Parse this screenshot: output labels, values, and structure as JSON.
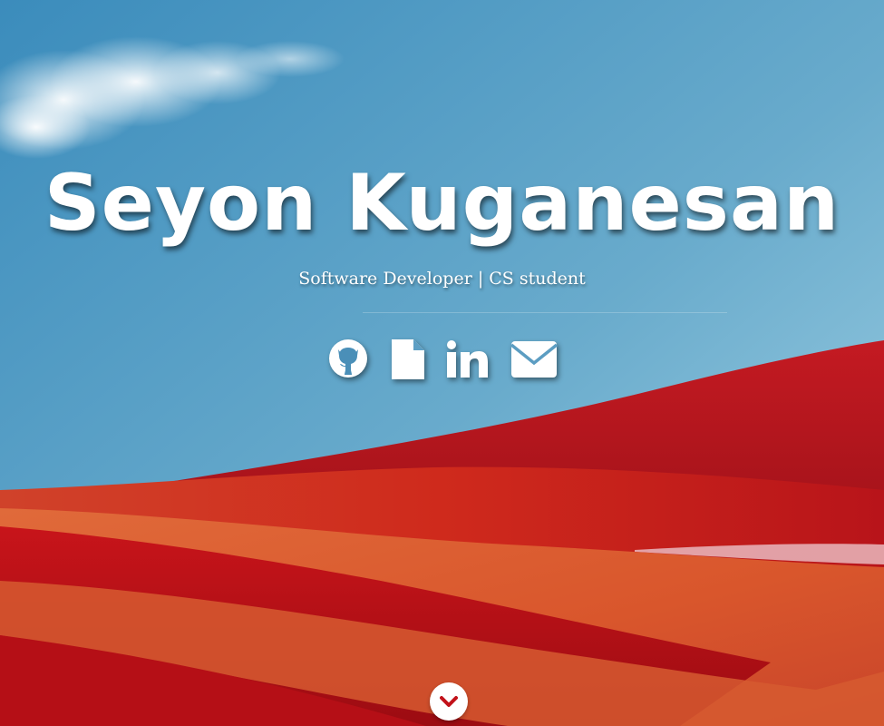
{
  "hero": {
    "name": "Seyon Kuganesan",
    "tagline": "Software Developer | CS student"
  },
  "social_links": [
    {
      "icon": "github-icon"
    },
    {
      "icon": "file-icon"
    },
    {
      "icon": "linkedin-icon"
    },
    {
      "icon": "envelope-icon"
    }
  ],
  "scroll_button": {
    "icon": "chevron-down-icon"
  },
  "colors": {
    "sky_top": "#3d8fbe",
    "sky_bottom": "#8fc6dd",
    "hill_red": "#b3121c",
    "field_orange": "#d8532c",
    "text": "#ffffff"
  }
}
